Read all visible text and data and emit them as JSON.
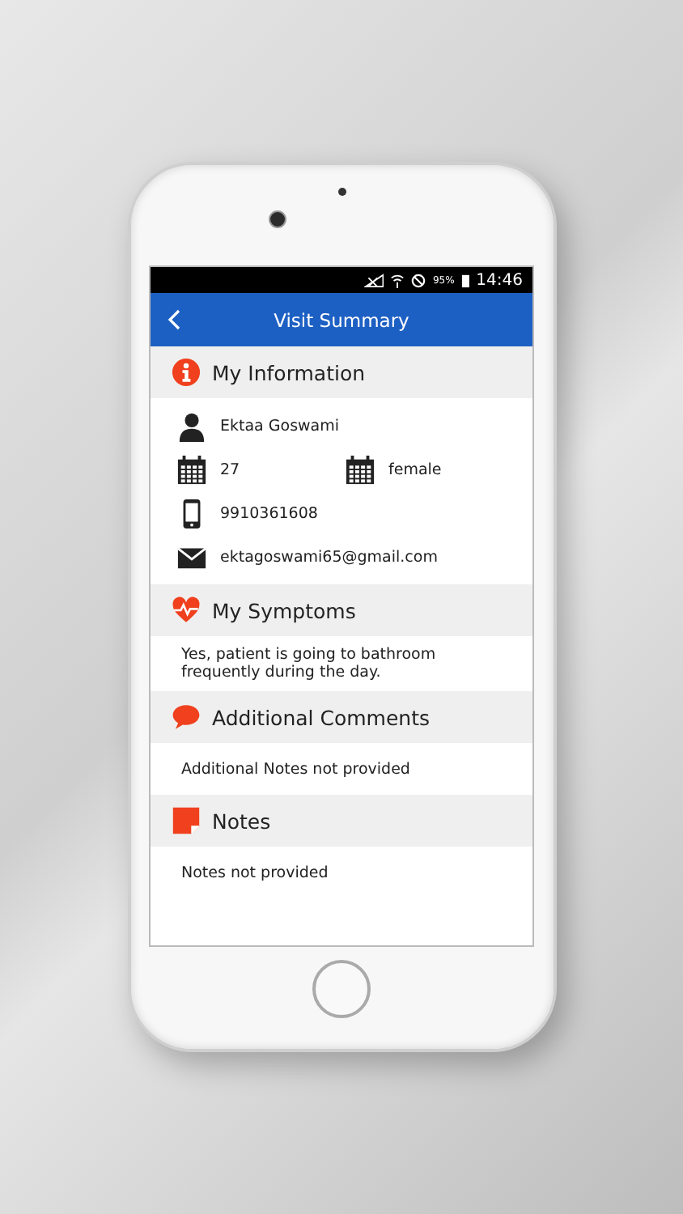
{
  "status_bar": {
    "battery": "95%",
    "time": "14:46"
  },
  "header": {
    "title": "Visit Summary"
  },
  "sections": [
    {
      "kind": "info",
      "title": "My Information",
      "fields": [
        {
          "kind": "person",
          "value": "Ektaa Goswami"
        },
        {
          "kind": "calendar",
          "value": "27"
        },
        {
          "kind": "calendar",
          "value": "female"
        },
        {
          "kind": "phone",
          "value": "9910361608"
        },
        {
          "kind": "mail",
          "value": "ektagoswami65@gmail.com"
        }
      ]
    },
    {
      "kind": "heart",
      "title": "My Symptoms",
      "text": "Yes, patient is going to bathroom frequently during the day."
    },
    {
      "kind": "speech",
      "title": "Additional Comments",
      "text": "Additional Notes not provided"
    },
    {
      "kind": "note",
      "title": "Notes",
      "text": "Notes not provided"
    }
  ]
}
